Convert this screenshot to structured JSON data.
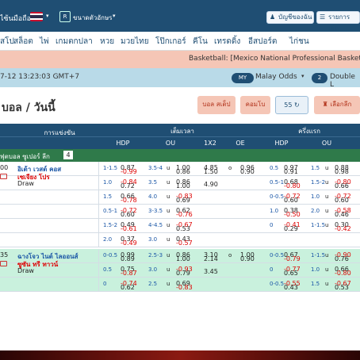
{
  "topbar": {
    "left_text": "ไซ้นมือถือ",
    "lang_text": "ขนาดตัวอักษร",
    "account": "บัญชีของฉัน",
    "statement": "รายการเล่น"
  },
  "nav": {
    "items": [
      "สโป",
      "สล็อต",
      "ไพ่",
      "เกมตกปลา",
      "หวย",
      "มวยไทย",
      "โป๊กเกอร์",
      "คีโน",
      "เทรดดิ้ง",
      "อีสปอร์ต",
      "ไก่ชน"
    ]
  },
  "banner": {
    "text": "Basketball: [Mexico National Professional Basketball"
  },
  "subbar": {
    "time": "7-12 13:23:03 GMT+7",
    "odds_badge": "MY",
    "odds_type": "Malay Odds",
    "line_badge": "2",
    "line_type": "Double L"
  },
  "toolbar": {
    "title": "บอล / วันนี้",
    "btn_single": "บอล สเต็ป",
    "btn_live": "คอมโบ",
    "count": "55",
    "btn_select": "เลือกลีก",
    "select_count": "2"
  },
  "header": {
    "fulltime": "เต็มเวลา",
    "halftime": "ครึ่งแรก",
    "match": "การแข่งขัน",
    "hdp": "HDP",
    "ou": "OU",
    "x12": "1X2",
    "oe": "OE",
    "hdp2": "HDP",
    "ou2": "OU"
  },
  "league": {
    "name": "ฟุตบอล ซูเปอร์ ลีก",
    "count": "4"
  },
  "matches": [
    {
      "time": "00",
      "home": "อิเต้า เวสต์ คอส",
      "away": "เซเจียง โปร",
      "draw": "Draw"
    },
    {
      "time": "35",
      "home": "ฉางโจว ไนต์ ไลออนส์",
      "away": "ซูซัน ทรี ทาวน์",
      "draw": "Draw"
    }
  ],
  "rows": [
    {
      "h1": "",
      "a1": "1-1.5",
      "v1": "0.87",
      "v2": "-0.99",
      "o1": "3.5-4",
      "u": "u",
      "o2": "1.00",
      "o3": "0.86",
      "x1": "4.85",
      "x2": "1.50",
      "x3": "4.90",
      "e1": "o",
      "e2": "u",
      "oe1": "0.96",
      "oe2": "0.90",
      "hh": "0.5",
      "hv1": "0.97",
      "hv2": "0.91",
      "ho": "1.5",
      "hu": "u",
      "ho1": "0.88",
      "ho2": "0.98"
    },
    {
      "h1": "1.0",
      "v1": "-0.84",
      "v2": "0.72",
      "o1": "3.5",
      "u": "u",
      "o2": "0.86",
      "o3": "1.00",
      "hh": "0.5-1",
      "hv1": "0.68",
      "hv2": "-0.80",
      "ho": "1.5-2",
      "hu": "u",
      "ho1": "-0.80",
      "ho2": "0.66"
    },
    {
      "h1": "1.5",
      "v1": "0.66",
      "v2": "-0.78",
      "o1": "4.0",
      "u": "u",
      "o2": "-0.83",
      "o3": "0.69",
      "hh": "0-0.5",
      "hv1": "-0.72",
      "hv2": "0.60",
      "ho": "1.0",
      "hu": "u",
      "ho1": "-0.72",
      "ho2": "0.60"
    },
    {
      "h1": "0.5-1",
      "v1": "-0.72",
      "v2": "0.60",
      "o1": "3-3.5",
      "u": "u",
      "o2": "0.62",
      "o3": "-0.76",
      "hh": "1.0",
      "hv1": "0.38",
      "hv2": "-0.50",
      "ho": "2.0",
      "hu": "u",
      "ho1": "-0.58",
      "ho2": "0.46"
    },
    {
      "h1": "1.5-2",
      "v1": "0.49",
      "v2": "-0.61",
      "o1": "4-4.5",
      "u": "u",
      "o2": "-0.67",
      "o3": "0.53",
      "hh": "0",
      "hv1": "-0.41",
      "hv2": "0.29",
      "ho": "1-1.5",
      "hu": "u",
      "ho1": "0.30",
      "ho2": "-0.42"
    },
    {
      "h1": "2.0",
      "v1": "0.37",
      "v2": "-0.49",
      "o1": "3.0",
      "u": "u",
      "o2": "0.43",
      "o3": "-0.57",
      "hh": "",
      "hv1": "",
      "hv2": "",
      "ho": "",
      "hu": "",
      "ho1": "",
      "ho2": ""
    },
    {
      "h1": "0-0.5",
      "v1": "0.99",
      "v2": "0.89",
      "o1": "2.5-3",
      "u": "u",
      "o2": "0.86",
      "o3": "1.00",
      "x1": "3.10",
      "x2": "2.14",
      "x3": "3.45",
      "e1": "o",
      "e2": "u",
      "oe1": "1.00",
      "oe2": "0.90",
      "hh": "0-0.5",
      "hv1": "0.67",
      "hv2": "-0.79",
      "ho": "1-1.5",
      "hu": "u",
      "ho1": "-0.90",
      "ho2": "0.76"
    },
    {
      "h1": "0.5",
      "v1": "0.75",
      "v2": "-0.87",
      "o1": "3.0",
      "u": "u",
      "o2": "-0.93",
      "o3": "0.79",
      "hh": "0",
      "hv1": "-0.77",
      "hv2": "0.65",
      "ho": "1.0",
      "hu": "u",
      "ho1": "0.66",
      "ho2": "-0.80"
    },
    {
      "h1": "0",
      "v1": "-0.74",
      "v2": "0.62",
      "o1": "2.5",
      "u": "u",
      "o2": "0.69",
      "o3": "-0.83",
      "hh": "0-0.5",
      "hv1": "-0.55",
      "hv2": "0.43",
      "ho": "1.5",
      "hu": "u",
      "ho1": "-0.67",
      "ho2": "0.53"
    }
  ]
}
